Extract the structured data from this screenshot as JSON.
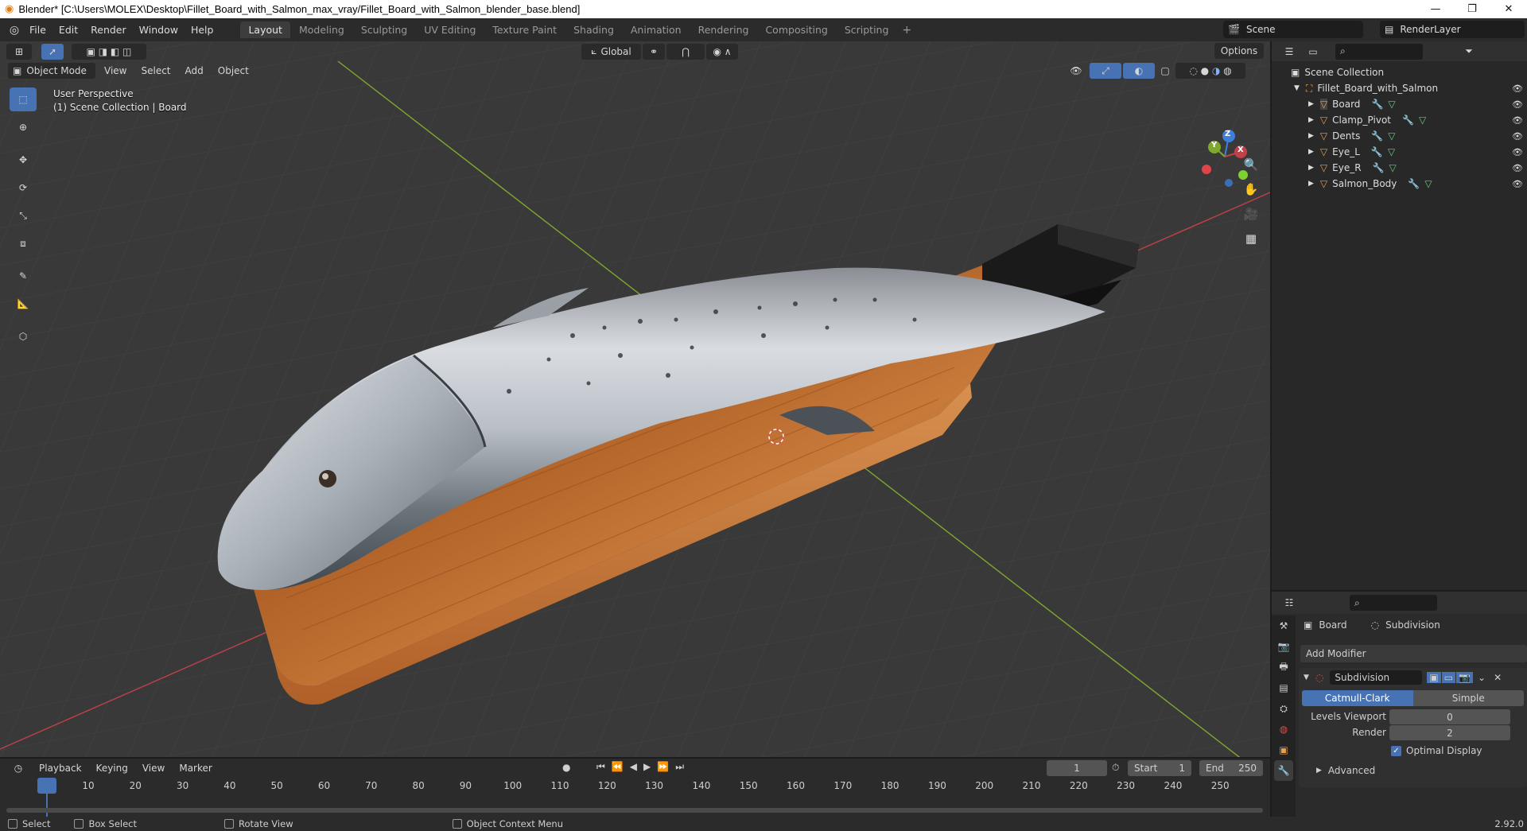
{
  "window": {
    "title": "Blender* [C:\\Users\\MOLEX\\Desktop\\Fillet_Board_with_Salmon_max_vray/Fillet_Board_with_Salmon_blender_base.blend]",
    "minimize": "—",
    "maximize": "❐",
    "close": "✕"
  },
  "menu": {
    "items": [
      "File",
      "Edit",
      "Render",
      "Window",
      "Help"
    ]
  },
  "workspaces": {
    "tabs": [
      "Layout",
      "Modeling",
      "Sculpting",
      "UV Editing",
      "Texture Paint",
      "Shading",
      "Animation",
      "Rendering",
      "Compositing",
      "Scripting"
    ],
    "active": "Layout",
    "add": "+"
  },
  "scene": {
    "name": "Scene",
    "view_layer": "RenderLayer"
  },
  "viewport": {
    "mode": "Object Mode",
    "menus": [
      "View",
      "Select",
      "Add",
      "Object"
    ],
    "orientation": "Global",
    "options": "Options",
    "perspective": "User Perspective",
    "collection_info": "(1) Scene Collection | Board",
    "gizmo": {
      "x": "X",
      "y": "Y",
      "z": "Z"
    }
  },
  "outliner": {
    "root": "Scene Collection",
    "collection": "Fillet_Board_with_Salmon",
    "objects": [
      "Board",
      "Clamp_Pivot",
      "Dents",
      "Eye_L",
      "Eye_R",
      "Salmon_Body"
    ]
  },
  "properties": {
    "object": "Board",
    "modifier_context": "Subdivision",
    "add_modifier": "Add Modifier",
    "modifier_name": "Subdivision",
    "algorithms": [
      "Catmull-Clark",
      "Simple"
    ],
    "active_algorithm": "Catmull-Clark",
    "levels_viewport_label": "Levels Viewport",
    "levels_viewport": "0",
    "render_label": "Render",
    "render": "2",
    "optimal_display": "Optimal Display",
    "advanced": "Advanced",
    "version": "2.92.0"
  },
  "timeline": {
    "menus": [
      "Playback",
      "Keying",
      "View",
      "Marker"
    ],
    "current_frame": "1",
    "start_label": "Start",
    "start": "1",
    "end_label": "End",
    "end": "250",
    "ticks": [
      "1",
      "10",
      "20",
      "30",
      "40",
      "50",
      "60",
      "70",
      "80",
      "90",
      "100",
      "110",
      "120",
      "130",
      "140",
      "150",
      "160",
      "170",
      "180",
      "190",
      "200",
      "210",
      "220",
      "230",
      "240",
      "250"
    ]
  },
  "status": {
    "select": "Select",
    "box_select": "Box Select",
    "rotate_view": "Rotate View",
    "context_menu": "Object Context Menu"
  },
  "colors": {
    "accent": "#4772b3",
    "viewport_bg": "#393939",
    "x_axis": "#c0414a",
    "y_axis": "#7fa82f",
    "z_axis": "#3f7fd9"
  }
}
